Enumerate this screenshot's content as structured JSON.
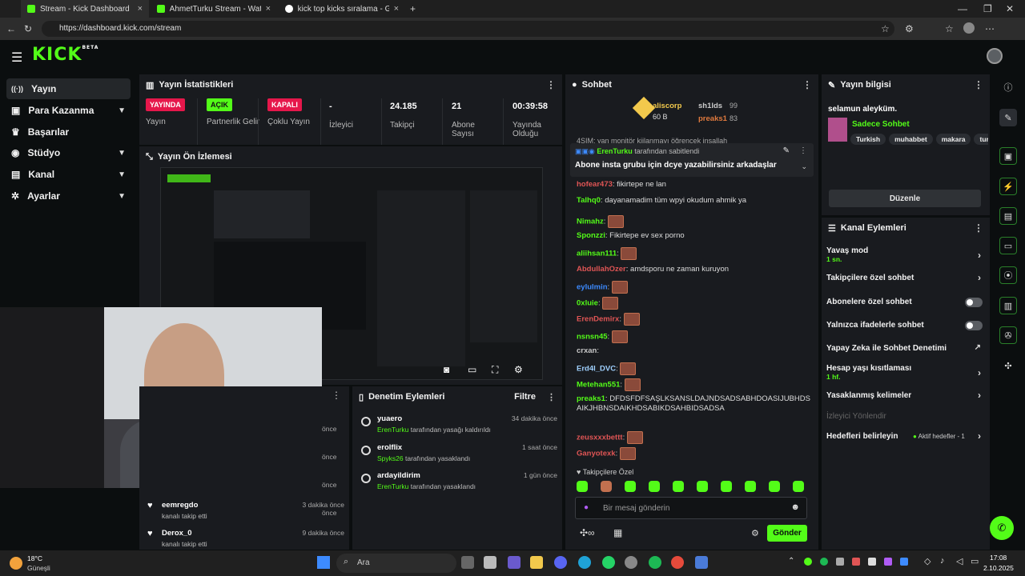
{
  "browser": {
    "tabs": [
      {
        "title": "Stream - Kick Dashboard",
        "active": true
      },
      {
        "title": "AhmetTurku Stream - Watch Live",
        "active": false
      },
      {
        "title": "kick top kicks sıralama - Google'd",
        "active": false
      }
    ],
    "url": "https://dashboard.kick.com/stream"
  },
  "brand": {
    "logo": "KICK",
    "beta": "BETA",
    "accent": "#53fc18"
  },
  "sidebar": {
    "items": [
      {
        "label": "Yayın",
        "icon": "broadcast-icon",
        "active": true,
        "chevron": false
      },
      {
        "label": "Para Kazanma",
        "icon": "money-icon",
        "active": false,
        "chevron": true
      },
      {
        "label": "Başarılar",
        "icon": "trophy-icon",
        "active": false,
        "chevron": false
      },
      {
        "label": "Stüdyo",
        "icon": "studio-icon",
        "active": false,
        "chevron": true
      },
      {
        "label": "Kanal",
        "icon": "channel-icon",
        "active": false,
        "chevron": true
      },
      {
        "label": "Ayarlar",
        "icon": "gear-icon",
        "active": false,
        "chevron": true
      }
    ]
  },
  "stats": {
    "title": "Yayın İstatistikleri",
    "items": [
      {
        "badge": "YAYINDA",
        "badge_color": "#e6174b",
        "label": "Yayın"
      },
      {
        "badge": "AÇIK",
        "badge_color": "#53fc18",
        "label": "Partnerlik Gelir"
      },
      {
        "badge": "KAPALI",
        "badge_color": "#e6174b",
        "label": "Çoklu Yayın"
      },
      {
        "value": "-",
        "label": "İzleyici"
      },
      {
        "value": "24.185",
        "label": "Takipçi"
      },
      {
        "value": "21",
        "label": "Abone Sayısı"
      },
      {
        "value": "00:39:58",
        "label": "Yayında Olduğu"
      }
    ]
  },
  "preview": {
    "title": "Yayın Ön İzlemesi"
  },
  "followers": {
    "rows": [
      {
        "name": "eemregdo",
        "desc": "kanalı takip etti",
        "time": "3 dakika önce"
      },
      {
        "name": "Derox_0",
        "desc": "kanalı takip etti",
        "time": "9 dakika önce"
      }
    ],
    "left_times": [
      "önce",
      "önce",
      "önce",
      "önce"
    ]
  },
  "moderation": {
    "title": "Denetim Eylemleri",
    "filter": "Filtre",
    "rows": [
      {
        "name": "yuaero",
        "actor": "ErenTurku",
        "action": "tarafından yasağı kaldırıldı",
        "time": "34 dakika önce",
        "icon": "undo-icon"
      },
      {
        "name": "erolflix",
        "actor": "Spyks26",
        "action": "tarafından yasaklandı",
        "time": "1 saat önce",
        "icon": "ban-icon"
      },
      {
        "name": "ardayildirim",
        "actor": "ErenTurku",
        "action": "tarafından yasaklandı",
        "time": "1 gün önce",
        "icon": "ban-icon"
      }
    ]
  },
  "chat": {
    "title": "Sohbet",
    "top_gifters": [
      {
        "name": "aliscorp",
        "amount": "60 B"
      },
      {
        "name": "sh1lds",
        "amount": "99"
      },
      {
        "name": "preaks1",
        "amount": "83"
      }
    ],
    "pinned": {
      "by": "ErenTurku",
      "by_suffix": "tarafından sabitlendi",
      "text": "Abone insta grubu için dcye yazabilirsiniz arkadaşlar"
    },
    "partial_top": "4SIM: yan monitör kiilanmayı öğrencek insallah",
    "messages": [
      {
        "user": "hofear473",
        "color": "#e05555",
        "text": "fikirtepe ne lan",
        "emote": false
      },
      {
        "user": "Talhq0",
        "color": "#53fc18",
        "text": "dayanamadim tüm wpyi okudum ahmik ya",
        "emote": false
      },
      {
        "user": "Nimahz",
        "color": "#53fc18",
        "text": "",
        "emote": true
      },
      {
        "user": "Sponzzi",
        "color": "#53fc18",
        "text": "Fikirtepe ev sex porno",
        "emote": false
      },
      {
        "user": "aliihsan111",
        "color": "#53fc18",
        "text": "",
        "emote": true
      },
      {
        "user": "AbdullahOzer",
        "color": "#e05555",
        "text": "amdsporu ne zaman kuruyon",
        "emote": false
      },
      {
        "user": "eylulmin",
        "color": "#3d8bff",
        "text": "",
        "emote": true
      },
      {
        "user": "0xluie",
        "color": "#53fc18",
        "text": "",
        "emote": true
      },
      {
        "user": "ErenDemirx",
        "color": "#e05555",
        "text": "",
        "emote": true
      },
      {
        "user": "nsnsn45",
        "color": "#53fc18",
        "text": "",
        "emote": true
      },
      {
        "user": "crxan",
        "color": "#c8c8c8",
        "text": "",
        "emote": false
      },
      {
        "user": "Erd4l_DVC",
        "color": "#9fd0ff",
        "text": "",
        "emote": true
      },
      {
        "user": "Metehan551",
        "color": "#53fc18",
        "text": "",
        "emote": true
      },
      {
        "user": "preaks1",
        "color": "#53fc18",
        "text": "DFDSFDFSAŞLKSANSLDAJNDSADSABHDOASIJUBHDSAIKJHBNSDAIKHDSABIKDSAHBIDSADSA",
        "emote": false
      },
      {
        "user": "zeusxxxbettt",
        "color": "#e05555",
        "text": "",
        "emote": true
      },
      {
        "user": "Ganyotexk",
        "color": "#e05555",
        "text": "",
        "emote": true
      }
    ],
    "followers_only": "Takipçilere Özel",
    "input_placeholder": "Bir mesaj gönderin",
    "send": "Gönder"
  },
  "stream_info": {
    "title": "Yayın bilgisi",
    "stream_title": "selamun aleyküm.",
    "category": "Sadece Sohbet",
    "tags": [
      "Turkish",
      "muhabbet",
      "makara",
      "turk"
    ],
    "edit": "Düzenle"
  },
  "channel_actions": {
    "title": "Kanal Eylemleri",
    "items": [
      {
        "label": "Yavaş mod",
        "sub": "1 sn.",
        "control": "arrow"
      },
      {
        "label": "Takipçilere özel sohbet",
        "sub": "",
        "control": "arrow"
      },
      {
        "label": "Abonelere özel sohbet",
        "sub": "",
        "control": "toggle"
      },
      {
        "label": "Yalnızca ifadelerle sohbet",
        "sub": "",
        "control": "toggle"
      },
      {
        "label": "Yapay Zeka ile Sohbet Denetimi",
        "sub": "",
        "control": "external"
      },
      {
        "label": "Hesap yaşı kısıtlaması",
        "sub": "1 hf.",
        "control": "arrow"
      },
      {
        "label": "Yasaklanmış kelimeler",
        "sub": "",
        "control": "arrow"
      },
      {
        "label": "İzleyici Yönlendir",
        "sub": "",
        "control": "none"
      },
      {
        "label": "Hedefleri belirleyin",
        "sub": "Aktif hedefler - 1",
        "control": "arrow"
      }
    ]
  },
  "taskbar": {
    "weather_temp": "18°C",
    "weather_desc": "Güneşli",
    "search": "Ara",
    "time": "17:08",
    "date": "2.10.2025"
  }
}
